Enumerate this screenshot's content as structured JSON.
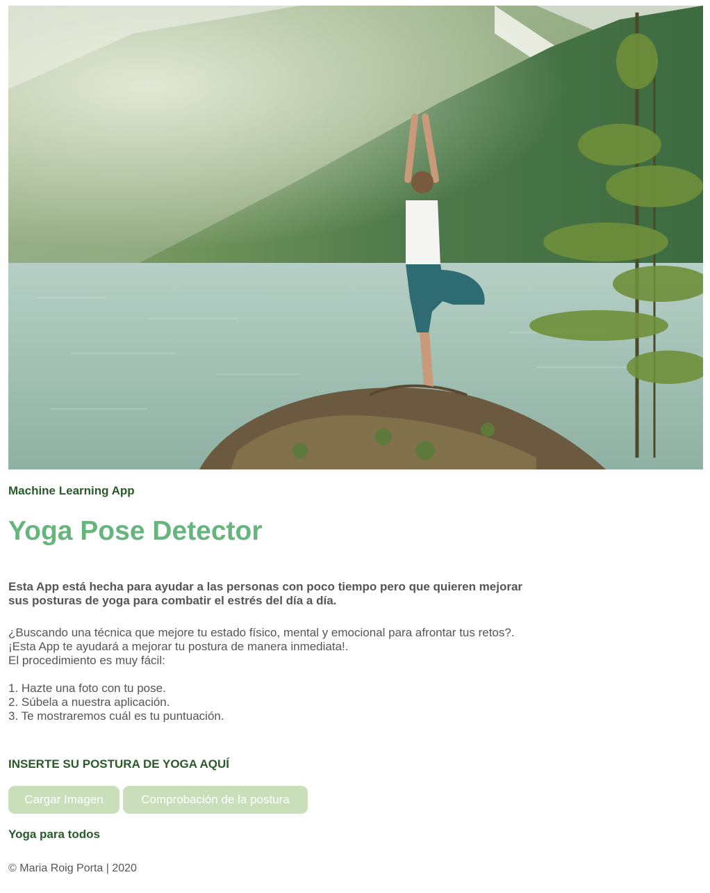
{
  "hero": {
    "image": "woman-tree-pose-by-lake"
  },
  "header": {
    "eyebrow": "Machine Learning App",
    "title": "Yoga Pose Detector"
  },
  "intro": {
    "line1": "Esta App está hecha para ayudar a las personas con poco tiempo pero que quieren mejorar",
    "line2": "sus posturas de yoga para combatir el estrés del día a día."
  },
  "body": {
    "lines": [
      "¿Buscando una técnica que mejore tu estado físico, mental y emocional para afrontar tus retos?.",
      "¡Esta App te ayudará a mejorar tu postura de manera inmediata!.",
      "El procedimiento es muy fácil:",
      "",
      "1. Hazte una foto con tu pose.",
      "2. Súbela a nuestra aplicación.",
      "3. Te mostraremos cuál es tu puntuación."
    ]
  },
  "upload": {
    "heading": "INSERTE SU POSTURA DE YOGA AQUÍ",
    "upload_label": "Cargar Imagen",
    "check_label": "Comprobación de la postura"
  },
  "footer": {
    "tagline": "Yoga para todos",
    "copyright": "© Maria Roig Porta | 2020"
  },
  "colors": {
    "title": "#66b57d",
    "heading": "#2a5a2a",
    "button_bg": "#c8dfb9"
  }
}
